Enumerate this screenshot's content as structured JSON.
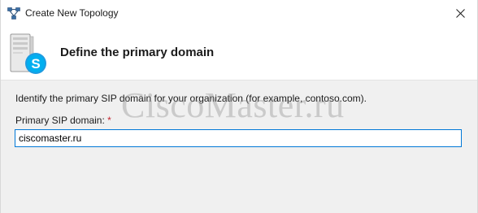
{
  "window": {
    "title": "Create New Topology",
    "icon": "topology-app-icon",
    "close_icon": "close-icon"
  },
  "header": {
    "title": "Define the primary domain",
    "icon": "skype-server-icon",
    "accent_color": "#0078d7"
  },
  "content": {
    "instruction": "Identify the primary SIP domain for your organization (for example, contoso.com).",
    "field_label": "Primary SIP domain:",
    "required_marker": "*",
    "required_color": "#c4262e",
    "field_value": "ciscomaster.ru"
  },
  "watermark": "CiscoMaster.ru"
}
